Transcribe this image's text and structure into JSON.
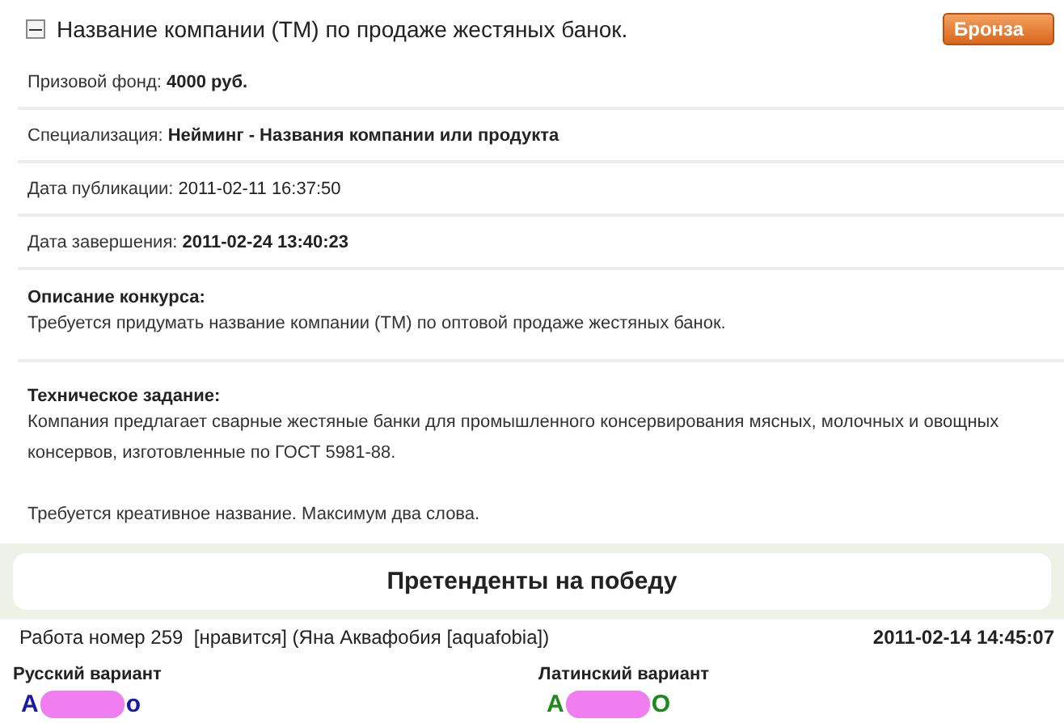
{
  "contest": {
    "title": "Название компании (ТМ) по продаже жестяных банок.",
    "expanded": true,
    "badge": "Бронза"
  },
  "fields": [
    {
      "label": "Призовой фонд:",
      "value": "4000 руб.",
      "bold": true
    },
    {
      "label": "Специализация:",
      "value": "Нейминг - Названия компании или продукта",
      "bold": true
    },
    {
      "label": "Дата публикации:",
      "value": "2011-02-11 16:37:50",
      "bold": false
    },
    {
      "label": "Дата завершения:",
      "value": "2011-02-24 13:40:23",
      "bold": true
    }
  ],
  "sections": [
    {
      "heading": "Описание конкурса:",
      "paragraphs": [
        "Требуется придумать название компании (ТМ) по оптовой продаже жестяных банок."
      ]
    },
    {
      "heading": "Техническое задание:",
      "paragraphs": [
        "Компания предлагает сварные жестяные банки для промышленного консервирования мясных, молочных и овощных консервов, изготовленные по ГОСТ 5981-88.",
        "Требуется креативное название. Максимум два слова."
      ]
    }
  ],
  "contenders": {
    "title": "Претенденты на победу",
    "entry": {
      "work": "Работа номер 259",
      "like": "[нравится]",
      "author": "(Яна Аквафобия [aquafobia])",
      "date": "2011-02-14 14:45:07",
      "variants": [
        {
          "label": "Русский вариант",
          "start": "А",
          "end": "о",
          "color": "#1a1aa6"
        },
        {
          "label": "Латинский вариант",
          "start": "А",
          "end": "O",
          "color": "#1a8a1a"
        }
      ]
    }
  }
}
